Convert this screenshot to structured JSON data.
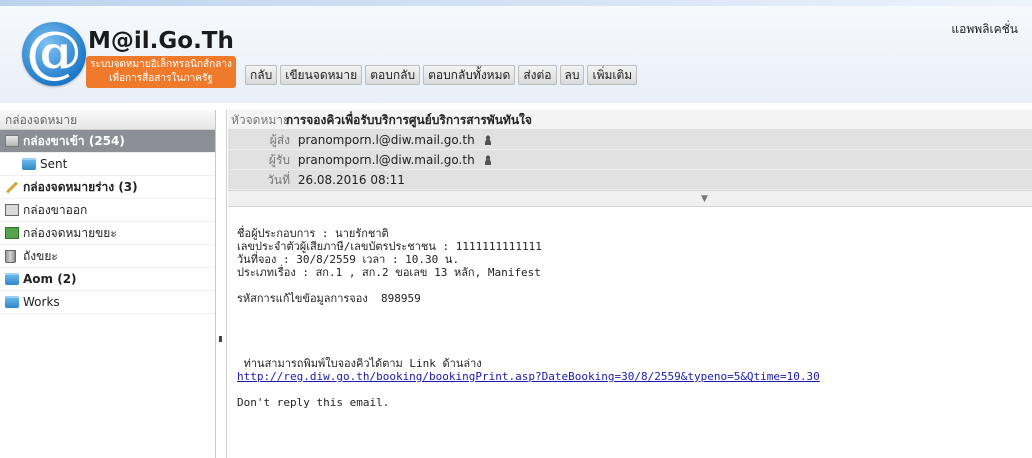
{
  "app": {
    "apps_link": "แอพพลิเคชั่น",
    "logo_letter": "@",
    "logo_title": "M@il.Go.Th",
    "logo_subtitle_1": "ระบบจดหมายอิเล็กทรอนิกส์กลาง",
    "logo_subtitle_2": "เพื่อการสื่อสารในภาครัฐ"
  },
  "toolbar": {
    "back": "กลับ",
    "compose": "เขียนจดหมาย",
    "reply": "ตอบกลับ",
    "reply_all": "ตอบกลับทั้งหมด",
    "forward": "ส่งต่อ",
    "delete": "ลบ",
    "more": "เพิ่มเติม"
  },
  "sidebar": {
    "header": "กล่องจดหมาย",
    "folders": [
      {
        "label": "กล่องขาเข้า (254)",
        "icon": "inbox-icon",
        "selected": true
      },
      {
        "label": "Sent",
        "icon": "folder-icon"
      },
      {
        "label": "กล่องจดหมายร่าง (3)",
        "icon": "pencil-icon"
      },
      {
        "label": "กล่องขาออก",
        "icon": "outbox-icon"
      },
      {
        "label": "กล่องจดหมายขยะ",
        "icon": "spam-icon"
      },
      {
        "label": "ถังขยะ",
        "icon": "trash-icon"
      },
      {
        "label": "Aom (2)",
        "icon": "folder-icon"
      },
      {
        "label": "Works",
        "icon": "folder-icon"
      }
    ]
  },
  "message": {
    "subject_label": "หัวจดหมาย",
    "subject": "การจองคิวเพื่อรับบริการศูนย์บริการสารพันทันใจ",
    "from_label": "ผู้ส่ง",
    "from": "pranomporn.l@diw.mail.go.th",
    "to_label": "ผู้รับ",
    "to": "pranomporn.l@diw.mail.go.th",
    "date_label": "วันที่",
    "date": "26.08.2016 08:11",
    "body": {
      "line1": "ชื่อผู้ประกอบการ : นายรักชาติ",
      "line2": "เลขประจำตัวผู้เสียภาษี/เลขบัตรประชาชน : 1111111111111",
      "line3": "วันที่จอง : 30/8/2559 เวลา : 10.30 น.",
      "line4": "ประเภทเรื่อง : สก.1 , สก.2 ขอเลข 13 หลัก, Manifest",
      "line5": "รหัสการแก้ไขข้อมูลการจอง  898959",
      "line6": " ท่านสามารถพิมพ์ใบจองคิวได้ตาม Link ด้านล่าง",
      "link": "http://reg.diw.go.th/booking/bookingPrint.asp?DateBooking=30/8/2559&typeno=5&Qtime=10.30",
      "line7": "Don't reply this email."
    }
  }
}
